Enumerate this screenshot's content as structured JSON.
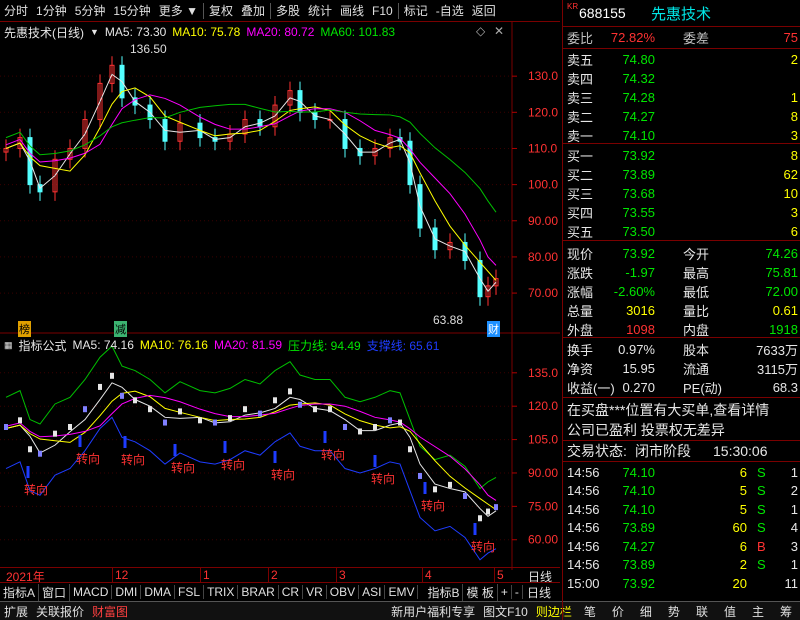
{
  "toolbar": {
    "items": [
      "分时",
      "1分钟",
      "5分钟",
      "15分钟",
      "更多",
      "复权",
      "叠加",
      "多股",
      "统计",
      "画线",
      "F10",
      "标记",
      "-自选",
      "返回"
    ]
  },
  "main_chart": {
    "indicator_title": "先惠技术(日线)",
    "ma5": "MA5: 73.30",
    "ma10": "MA10: 75.78",
    "ma20": "MA20: 80.72",
    "ma60": "MA60: 101.83",
    "high_label": "136.50",
    "low_label": "63.88",
    "badge_left": "榜",
    "badge_mid": "减",
    "badge_right": "财",
    "axis_ticks": [
      "130.0",
      "120.0",
      "110.0",
      "100.0",
      "90.00",
      "80.00",
      "70.00"
    ]
  },
  "sub_chart": {
    "indicator_title": "指标公式",
    "ma5": "MA5: 74.16",
    "ma10": "MA10: 76.16",
    "ma20": "MA20: 81.59",
    "pressure": "压力线: 94.49",
    "support": "支撑线: 65.61",
    "axis_ticks": [
      "135.0",
      "120.0",
      "105.0",
      "90.00",
      "75.00",
      "60.00"
    ],
    "signal": "转向"
  },
  "date_axis": {
    "labels": [
      "2021年",
      "12",
      "1",
      "2",
      "3",
      "4",
      "5"
    ],
    "period": "日线"
  },
  "bottom_tabs": [
    "指标A",
    "窗口",
    "MACD",
    "DMI",
    "DMA",
    "FSL",
    "TRIX",
    "BRAR",
    "CR",
    "VR",
    "OBV",
    "ASI",
    "EMV",
    "指标B",
    "模 板",
    "+",
    "-"
  ],
  "bottom_bar": {
    "left": [
      "扩展",
      "关联报价",
      "财富图"
    ],
    "middle": [
      "新用户福利专享",
      "图文F10",
      "则边栏"
    ],
    "right": [
      "笔",
      "价",
      "细",
      "势",
      "联",
      "值",
      "主",
      "筹"
    ]
  },
  "stock": {
    "code_prefix": "KR",
    "code": "688155",
    "name": "先惠技术"
  },
  "order_book": {
    "webi_label": "委比",
    "webi_value": "72.82%",
    "weicha_label": "委差",
    "weicha_value": "75",
    "asks": [
      {
        "label": "卖五",
        "price": "74.80",
        "vol": "2"
      },
      {
        "label": "卖四",
        "price": "74.32",
        "vol": ""
      },
      {
        "label": "卖三",
        "price": "74.28",
        "vol": "1"
      },
      {
        "label": "卖二",
        "price": "74.27",
        "vol": "8"
      },
      {
        "label": "卖一",
        "price": "74.10",
        "vol": "3"
      }
    ],
    "bids": [
      {
        "label": "买一",
        "price": "73.92",
        "vol": "8"
      },
      {
        "label": "买二",
        "price": "73.89",
        "vol": "62"
      },
      {
        "label": "买三",
        "price": "73.68",
        "vol": "10"
      },
      {
        "label": "买四",
        "price": "73.55",
        "vol": "3"
      },
      {
        "label": "买五",
        "price": "73.50",
        "vol": "6"
      }
    ]
  },
  "quote": [
    {
      "l1": "现价",
      "v1": "73.92",
      "l2": "今开",
      "v2": "74.26",
      "c1": "green",
      "c2": "green"
    },
    {
      "l1": "涨跌",
      "v1": "-1.97",
      "l2": "最高",
      "v2": "75.81",
      "c1": "green",
      "c2": "green"
    },
    {
      "l1": "涨幅",
      "v1": "-2.60%",
      "l2": "最低",
      "v2": "72.00",
      "c1": "green",
      "c2": "green"
    },
    {
      "l1": "总量",
      "v1": "3016",
      "l2": "量比",
      "v2": "0.61",
      "c1": "yellow",
      "c2": "yellow"
    },
    {
      "l1": "外盘",
      "v1": "1098",
      "l2": "内盘",
      "v2": "1918",
      "c1": "red",
      "c2": "green"
    }
  ],
  "stats": [
    {
      "l1": "换手",
      "v1": "0.97%",
      "l2": "股本",
      "v2": "7633万"
    },
    {
      "l1": "净资",
      "v1": "15.95",
      "l2": "流通",
      "v2": "3115万"
    },
    {
      "l1": "收益(一)",
      "v1": "0.270",
      "l2": "PE(动)",
      "v2": "68.3"
    }
  ],
  "news": [
    "在买盘***位置有大买单,查看详情",
    "公司已盈利 投票权无差异"
  ],
  "trade_status": {
    "label": "交易状态:",
    "value": "闭市阶段",
    "time": "15:30:06"
  },
  "ticks": [
    {
      "t": "14:56",
      "p": "74.10",
      "v": "6",
      "s": "S",
      "n": "1",
      "pc": "green",
      "sc": "green"
    },
    {
      "t": "14:56",
      "p": "74.10",
      "v": "5",
      "s": "S",
      "n": "2",
      "pc": "green",
      "sc": "green"
    },
    {
      "t": "14:56",
      "p": "74.10",
      "v": "5",
      "s": "S",
      "n": "1",
      "pc": "green",
      "sc": "green"
    },
    {
      "t": "14:56",
      "p": "73.89",
      "v": "60",
      "s": "S",
      "n": "4",
      "pc": "green",
      "sc": "green"
    },
    {
      "t": "14:56",
      "p": "74.27",
      "v": "6",
      "s": "B",
      "n": "3",
      "pc": "green",
      "sc": "red"
    },
    {
      "t": "14:56",
      "p": "73.89",
      "v": "2",
      "s": "S",
      "n": "1",
      "pc": "green",
      "sc": "green"
    },
    {
      "t": "15:00",
      "p": "73.92",
      "v": "20",
      "s": "",
      "n": "11",
      "pc": "green",
      "sc": "green"
    }
  ]
}
